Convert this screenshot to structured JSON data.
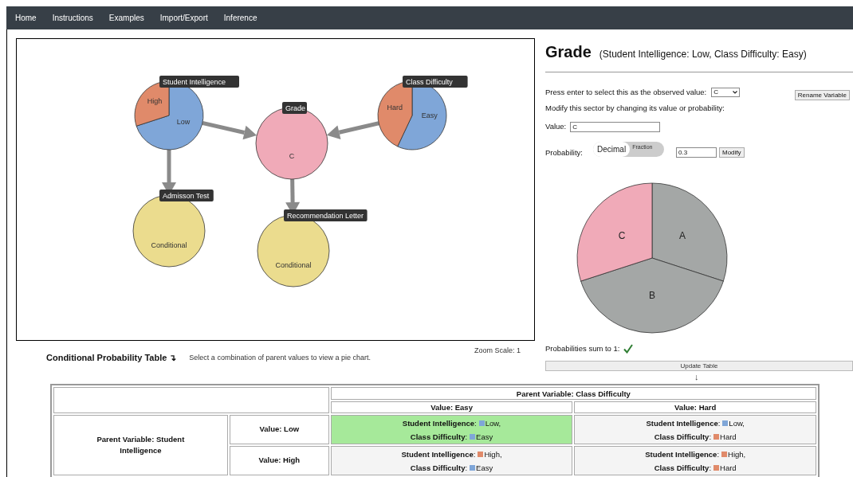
{
  "nav": [
    {
      "label": "Home"
    },
    {
      "label": "Instructions"
    },
    {
      "label": "Examples"
    },
    {
      "label": "Import/Export"
    },
    {
      "label": "Inference"
    }
  ],
  "graph": {
    "nodes": [
      {
        "kind": "pie",
        "title": "Student Intelligence",
        "slices": [
          {
            "label": "Low",
            "color": "#7fa6d8"
          },
          {
            "label": "High",
            "color": "#e08a6a"
          }
        ]
      },
      {
        "kind": "value",
        "title": "Grade",
        "value": "C",
        "color": "#f0aab8"
      },
      {
        "kind": "pie",
        "title": "Class Difficulty",
        "slices": [
          {
            "label": "Easy",
            "color": "#7fa6d8"
          },
          {
            "label": "Hard",
            "color": "#e08a6a"
          }
        ]
      },
      {
        "kind": "conditional",
        "title": "Admisson Test",
        "value": "Conditional",
        "color": "#ebdc8e"
      },
      {
        "kind": "conditional",
        "title": "Recommendation Letter",
        "value": "Conditional",
        "color": "#ebdc8e"
      }
    ],
    "zoom_label": "Zoom Scale: 1"
  },
  "cpt": {
    "title": "Conditional Probability Table",
    "toggle": "↴",
    "hint": "Select a combination of parent values to view a pie chart."
  },
  "panel": {
    "title": "Grade",
    "context": "(Student Intelligence: Low, Class Difficulty: Easy)",
    "observed_label": "Press enter to select this as the observed value:",
    "observed_value": "C",
    "rename_button": "Rename Variable",
    "modify_hint": "Modify this sector by changing its value or probability:",
    "value_label": "Value:",
    "value": "C",
    "probability_label": "Probability:",
    "formats": [
      {
        "label": "Decimal",
        "selected": true
      },
      {
        "label": "Fraction",
        "selected": false
      }
    ],
    "probability": "0.3",
    "modify_button": "Modify",
    "chart_data": {
      "type": "pie",
      "categories": [
        "A",
        "B",
        "C"
      ],
      "values": [
        0.3,
        0.4,
        0.3
      ],
      "colors": [
        "#a4a7a6",
        "#a4a7a6",
        "#f0aab8"
      ]
    },
    "sum_label": "Probabilities sum to 1:",
    "sum_ok": true,
    "update_button": "Update Table",
    "down_arrow": "↓"
  },
  "table": {
    "column_group": "Parent Variable: Class Difficulty",
    "columns": [
      "Value: Easy",
      "Value: Hard"
    ],
    "row_group": "Parent Variable: Student Intelligence",
    "rows": [
      {
        "label": "Value: Low",
        "cells": [
          {
            "selected": true,
            "parts": [
              {
                "label": "**Student Intelligence**:",
                "value": "Low,",
                "color": "#7fa6d8"
              },
              {
                "label": "**Class Difficulty**:",
                "value": "Easy",
                "color": "#7fa6d8"
              }
            ]
          },
          {
            "selected": false,
            "parts": [
              {
                "label": "**Student Intelligence**:",
                "value": "Low,",
                "color": "#7fa6d8"
              },
              {
                "label": "**Class Difficulty**:",
                "value": "Hard",
                "color": "#e08a6a"
              }
            ]
          }
        ]
      },
      {
        "label": "Value: High",
        "cells": [
          {
            "selected": false,
            "parts": [
              {
                "label": "**Student Intelligence**:",
                "value": "High,",
                "color": "#e08a6a"
              },
              {
                "label": "**Class Difficulty**:",
                "value": "Easy",
                "color": "#7fa6d8"
              }
            ]
          },
          {
            "selected": false,
            "parts": [
              {
                "label": "**Student Intelligence**:",
                "value": "High,",
                "color": "#e08a6a"
              },
              {
                "label": "**Class Difficulty**:",
                "value": "Hard",
                "color": "#e08a6a"
              }
            ]
          }
        ]
      }
    ]
  }
}
